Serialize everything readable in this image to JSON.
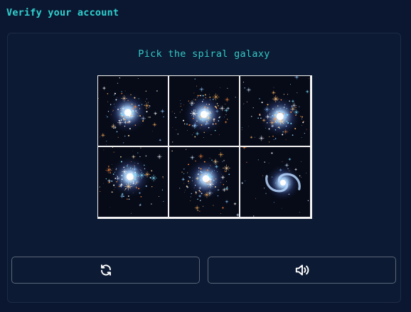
{
  "header": {
    "title": "Verify your account"
  },
  "captcha": {
    "prompt": "Pick the spiral galaxy",
    "tiles": [
      {
        "icon": "starburst-galaxy-image",
        "selected": false
      },
      {
        "icon": "starburst-galaxy-image",
        "selected": false
      },
      {
        "icon": "starburst-galaxy-image",
        "selected": false
      },
      {
        "icon": "starburst-galaxy-image",
        "selected": false
      },
      {
        "icon": "starburst-galaxy-image",
        "selected": false
      },
      {
        "icon": "spiral-galaxy-image",
        "selected": false
      }
    ],
    "buttons": {
      "refresh_icon": "refresh-icon",
      "audio_icon": "speaker-icon"
    }
  },
  "colors": {
    "background": "#0b1730",
    "accent": "#2fd0cf",
    "border": "#5b6678"
  }
}
